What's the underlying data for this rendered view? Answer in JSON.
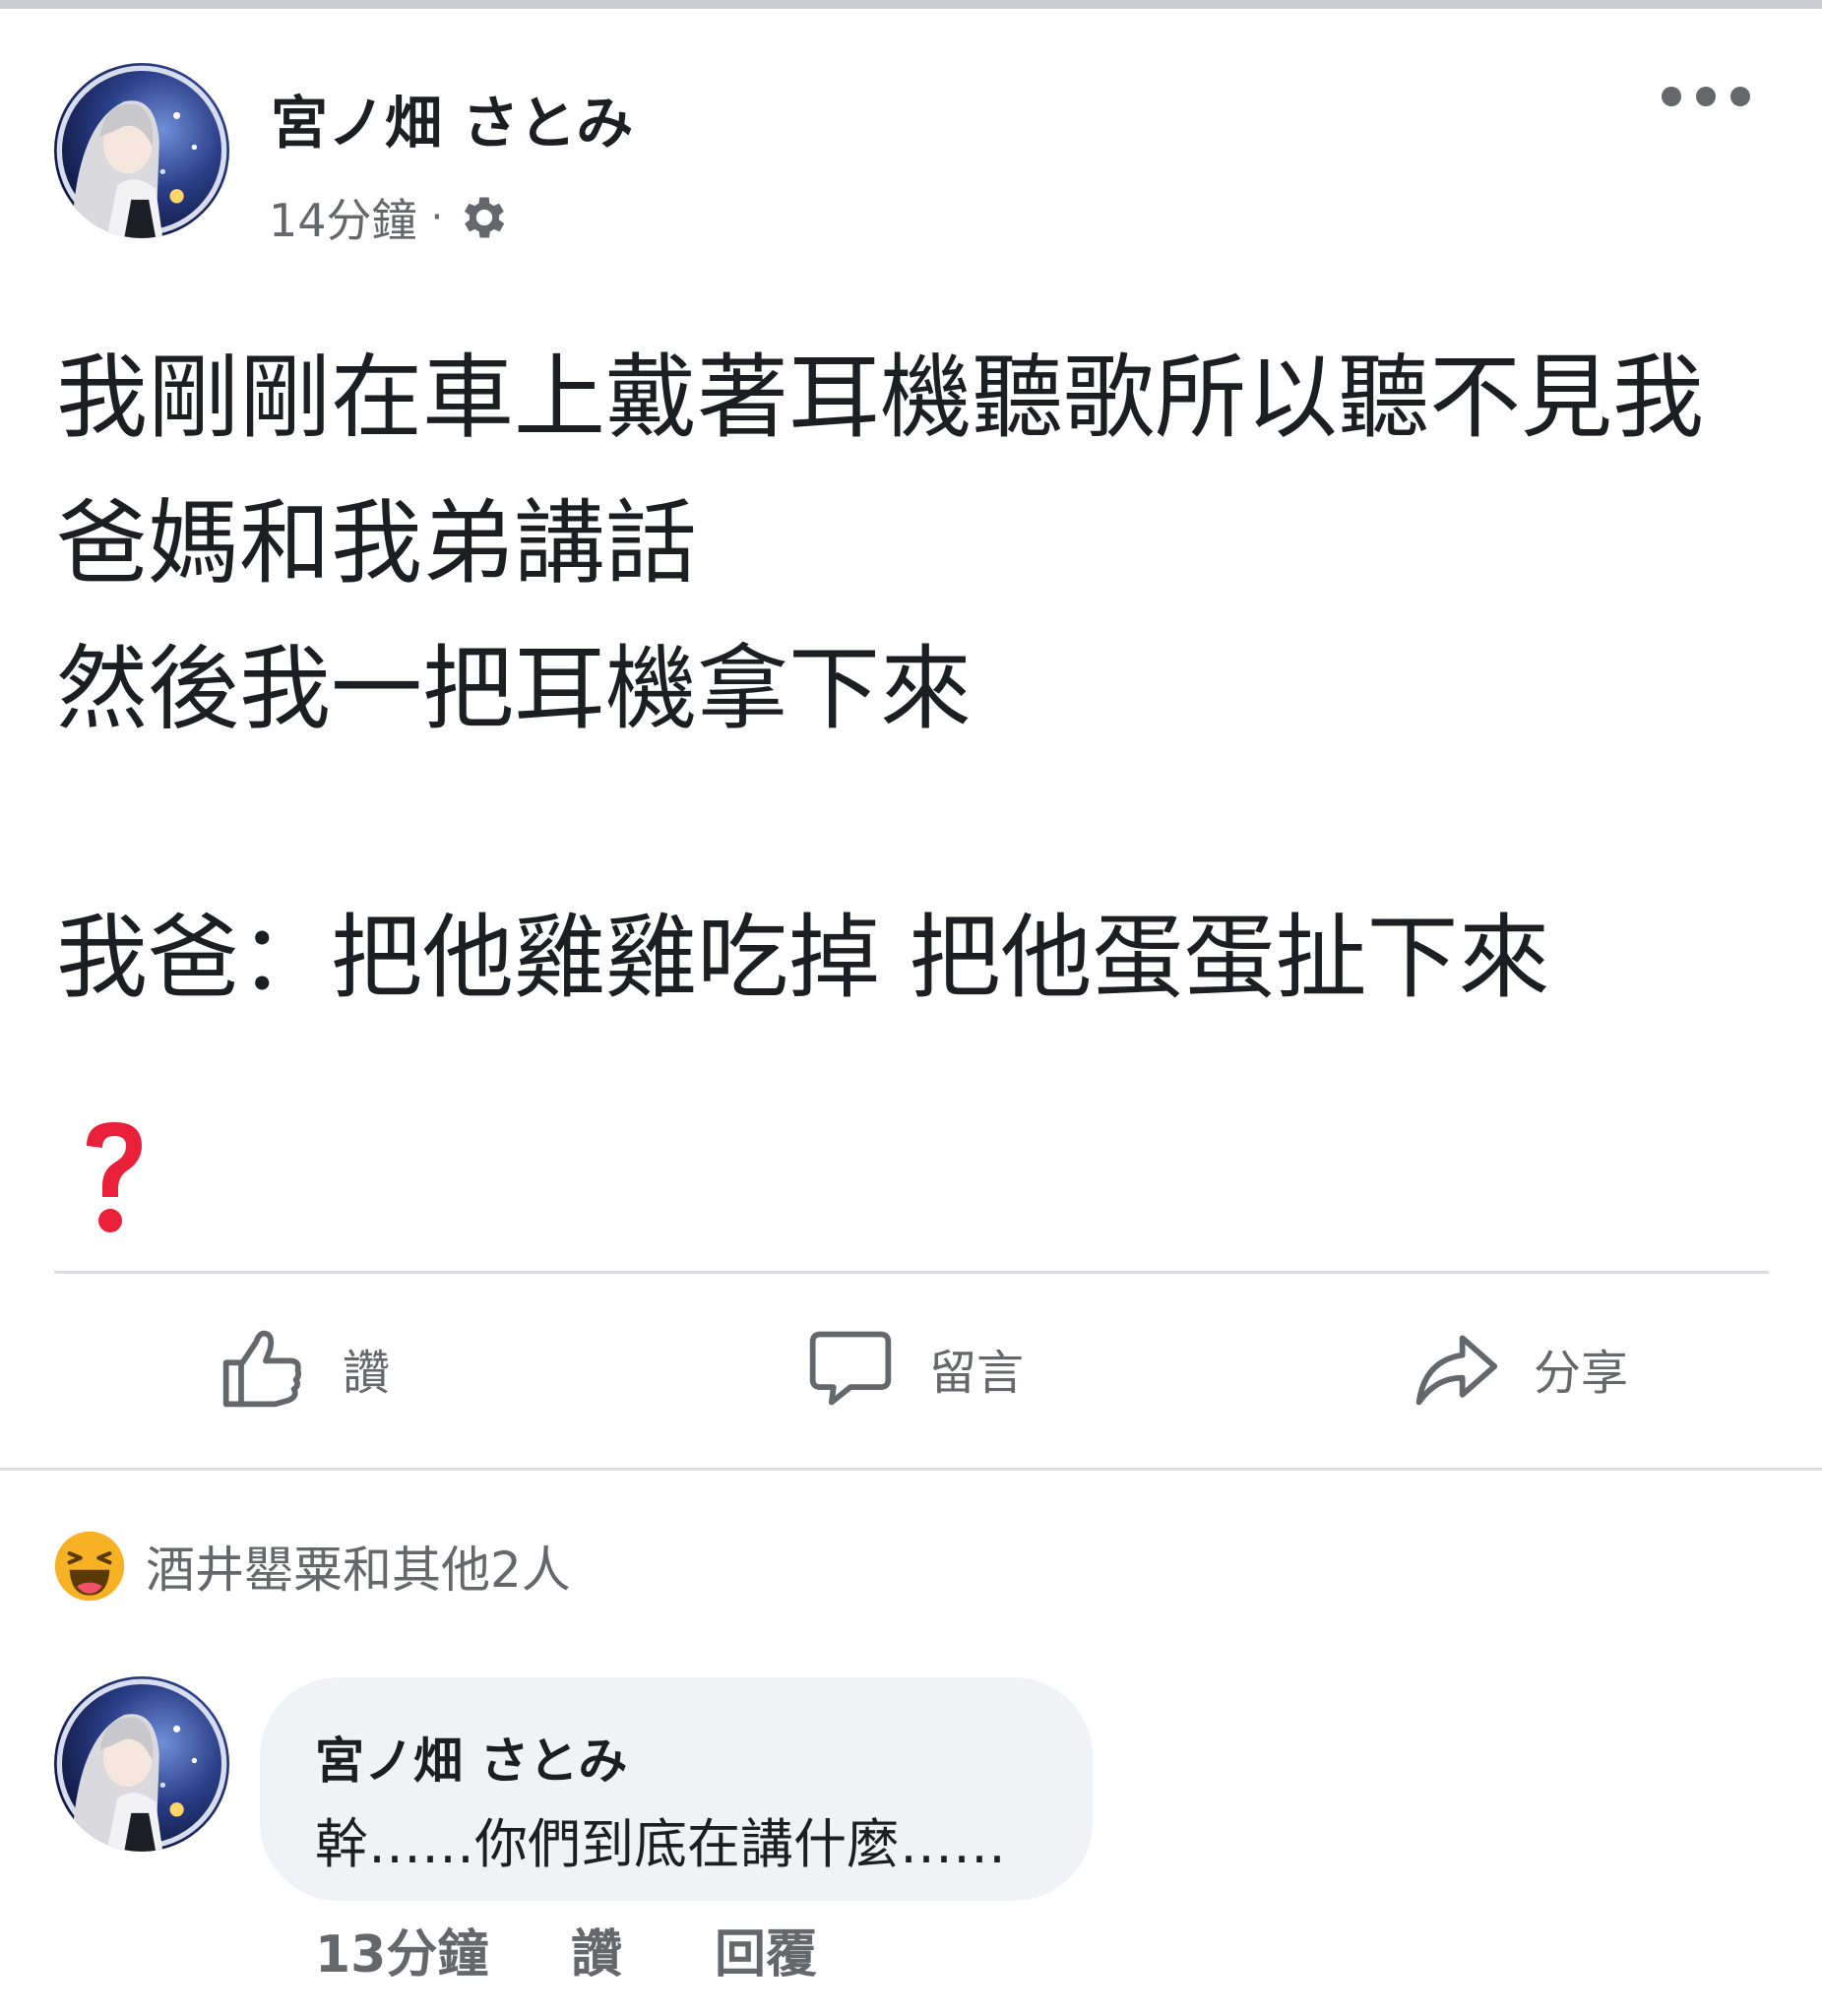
{
  "post": {
    "author": "宮ノ畑 さとみ",
    "time": "14分鐘",
    "separator": "·",
    "privacy_icon": "gear-icon",
    "more_icon": "more-options-icon",
    "body_lines": [
      "我剛剛在車上戴著耳機聽歌所以聽不見我",
      "爸媽和我弟講話",
      "然後我一把耳機拿下來",
      "我爸：把他雞雞吃掉 把他蛋蛋扯下來"
    ],
    "emoji": "question-mark-emoji"
  },
  "actions": {
    "like": "讚",
    "comment": "留言",
    "share": "分享"
  },
  "reactions": {
    "icon": "haha-reaction-icon",
    "summary": "酒井罌粟和其他2人"
  },
  "comment": {
    "author": "宮ノ畑 さとみ",
    "text": "幹……你們到底在講什麼……",
    "time": "13分鐘",
    "like": "讚",
    "reply": "回覆"
  },
  "colors": {
    "text": "#1c1e21",
    "secondary": "#65676b",
    "divider": "#dadde1",
    "bubble": "#f0f2f5",
    "emoji_red": "#e8203a"
  }
}
